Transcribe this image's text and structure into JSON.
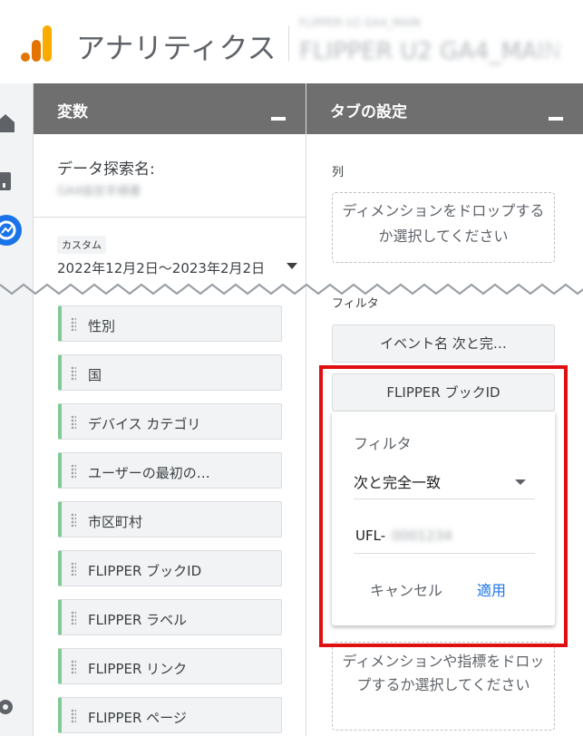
{
  "header": {
    "app_title": "アナリティクス",
    "account_small": "FLIPPER U2 GA4_MAIN",
    "property_name": "FLIPPER U2 GA4_MAIN"
  },
  "colors": {
    "accent": "#1a73e8",
    "panel_header": "#6f6f6f",
    "dim_stripe": "#81c995",
    "highlight": "#e01010",
    "logo_orange": "#f9ab00",
    "logo_dark": "#e37400"
  },
  "variables_panel": {
    "title": "変数",
    "explore_name_label": "データ探索名:",
    "explore_name_value": "GA4設定手順書",
    "custom_chip": "カスタム",
    "date_range": "2022年12月2日～2023年2月2日",
    "dimensions": [
      "性別",
      "国",
      "デバイス カテゴリ",
      "ユーザーの最初の…",
      "市区町村",
      "FLIPPER ブックID",
      "FLIPPER ラベル",
      "FLIPPER リンク",
      "FLIPPER ページ"
    ]
  },
  "tab_panel": {
    "title": "タブの設定",
    "column_label": "列",
    "column_drop": "ディメンションをドロップするか選択してください",
    "filter_label": "フィルタ",
    "filter_chip_1": "イベント名 次と完…",
    "filter_chip_2": "FLIPPER ブックID",
    "popup": {
      "title": "フィルタ",
      "match_type": "次と完全一致",
      "value_prefix": "UFL-",
      "value_rest": "0001234",
      "cancel": "キャンセル",
      "apply": "適用"
    },
    "value_drop": "ディメンションや指標をドロップするか選択してください"
  },
  "icons": [
    "home-icon",
    "reports-icon",
    "explore-icon",
    "settings-icon",
    "drag-handle-icon",
    "dropdown-caret-icon",
    "minimize-icon"
  ]
}
